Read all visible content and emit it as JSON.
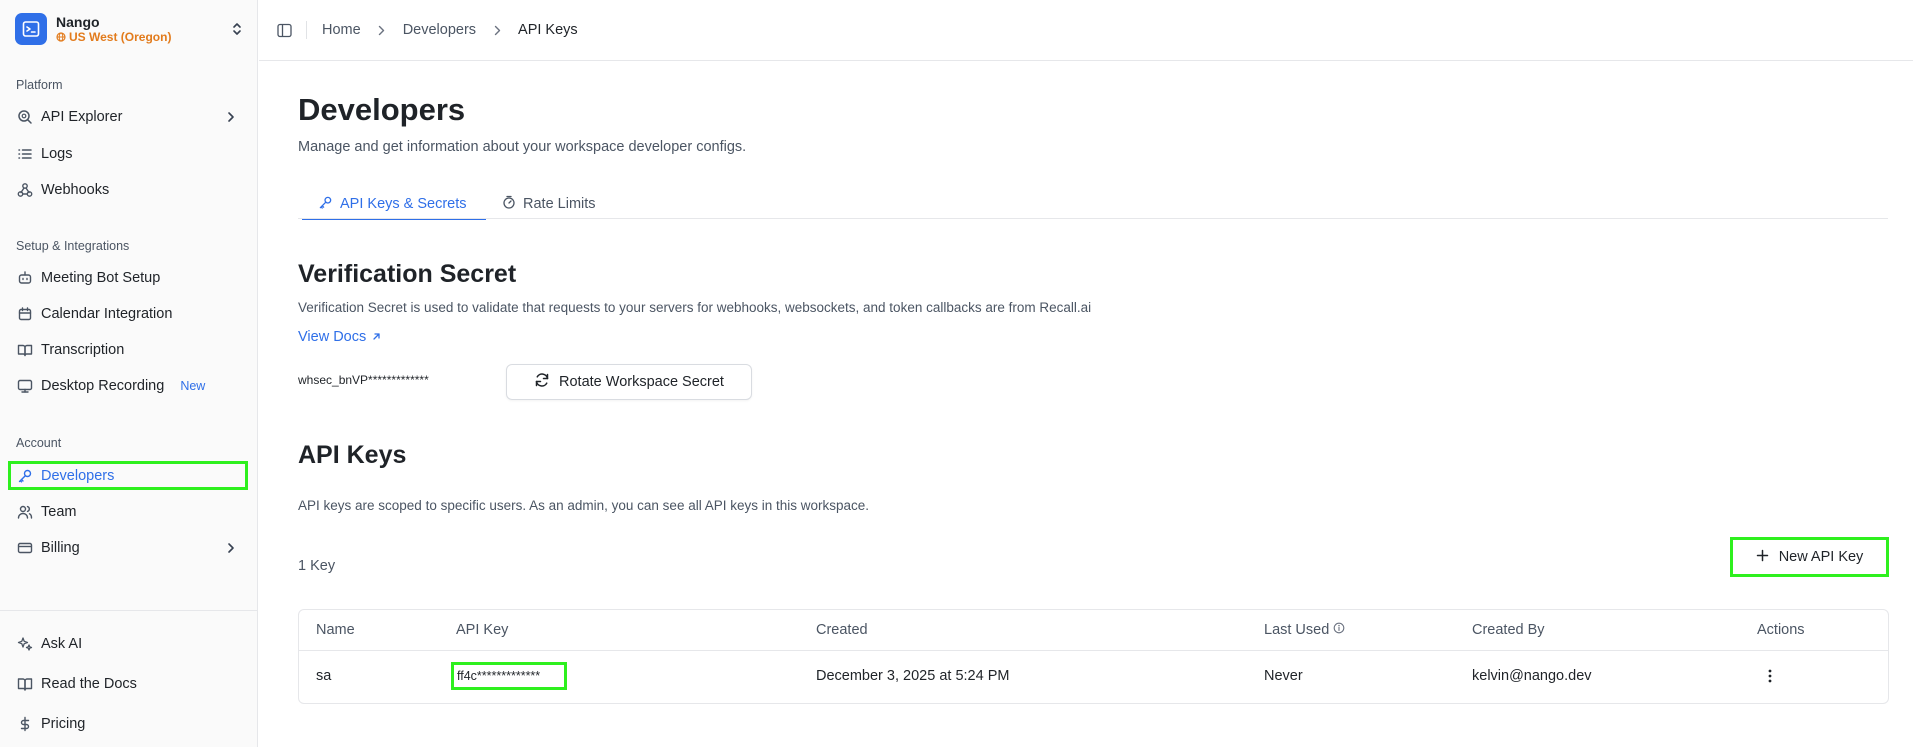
{
  "workspace": {
    "name": "Nango",
    "region": "US West (Oregon)"
  },
  "sidebar": {
    "platform_label": "Platform",
    "platform_items": [
      {
        "label": "API Explorer",
        "icon": "search-icon"
      },
      {
        "label": "Logs",
        "icon": "list-icon"
      },
      {
        "label": "Webhooks",
        "icon": "webhook-icon"
      }
    ],
    "setup_label": "Setup & Integrations",
    "setup_items": [
      {
        "label": "Meeting Bot Setup",
        "icon": "bot-icon"
      },
      {
        "label": "Calendar Integration",
        "icon": "calendar-icon"
      },
      {
        "label": "Transcription",
        "icon": "book-icon"
      },
      {
        "label": "Desktop Recording",
        "icon": "monitor-icon",
        "badge": "New"
      }
    ],
    "account_label": "Account",
    "account_items": [
      {
        "label": "Developers",
        "icon": "key-icon",
        "active": true
      },
      {
        "label": "Team",
        "icon": "users-icon"
      },
      {
        "label": "Billing",
        "icon": "credit-card-icon"
      }
    ],
    "footer_items": [
      {
        "label": "Ask AI",
        "icon": "sparkles-icon"
      },
      {
        "label": "Read the Docs",
        "icon": "open-book-icon"
      },
      {
        "label": "Pricing",
        "icon": "dollar-icon"
      }
    ]
  },
  "breadcrumb": [
    "Home",
    "Developers",
    "API Keys"
  ],
  "page": {
    "title": "Developers",
    "subtitle": "Manage and get information about your workspace developer configs.",
    "tabs": [
      {
        "label": "API Keys & Secrets",
        "icon": "key-icon",
        "active": true
      },
      {
        "label": "Rate Limits",
        "icon": "timer-icon",
        "active": false
      }
    ]
  },
  "verification": {
    "title": "Verification Secret",
    "description": "Verification Secret is used to validate that requests to your servers for webhooks, websockets, and token callbacks are from Recall.ai",
    "docs_link": "View Docs",
    "secret_value": "whsec_bnVP*************",
    "rotate_button": "Rotate Workspace Secret"
  },
  "api_keys": {
    "title": "API Keys",
    "description": "API keys are scoped to specific users. As an admin, you can see all API keys in this workspace.",
    "count_label": "1 Key",
    "new_button": "New API Key",
    "columns": [
      "Name",
      "API Key",
      "Created",
      "Last Used",
      "Created By",
      "Actions"
    ],
    "rows": [
      {
        "name": "sa",
        "key": "ff4c*************",
        "created": "December 3, 2025 at 5:24 PM",
        "last_used": "Never",
        "created_by": "kelvin@nango.dev"
      }
    ]
  },
  "colors": {
    "accent": "#2f6fe8",
    "region": "#e27b1c",
    "highlight": "#2ef01e"
  }
}
